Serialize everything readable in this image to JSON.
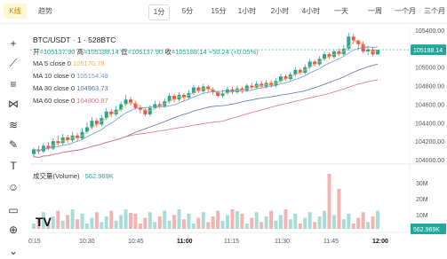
{
  "tabs": {
    "kline": "K线",
    "trend": "趋势"
  },
  "timeframes": [
    "1分",
    "5分",
    "15分",
    "1小时",
    "2小时",
    "4小时",
    "一天",
    "一周",
    "一个月",
    "三个月"
  ],
  "active_timeframe": "1分",
  "header": {
    "pair_line": "BTC/USDT · 1 · 528BTC",
    "ohlc": {
      "open_label": "开",
      "open": "=105137.90",
      "high_label": "高",
      "high": "=105188.14",
      "low_label": "低",
      "low": "=105137.90",
      "close_label": "收",
      "close": "=105188.14",
      "change": "+50.24 (+0.05%)"
    }
  },
  "ma_lines": [
    {
      "label": "MA 5 close 0",
      "value": "105170.78",
      "color": "#f5b342"
    },
    {
      "label": "MA 10 close 0",
      "value": "105154.49",
      "color": "#6f9ad8"
    },
    {
      "label": "MA 30 close 0",
      "value": "104963.73",
      "color": "#5a6fb0"
    },
    {
      "label": "MA 60 close 0",
      "value": "104800.87",
      "color": "#e8707a"
    }
  ],
  "volume": {
    "label": "成交量(Volume)",
    "value": "562.969K"
  },
  "price_axis": {
    "ticks": [
      "105400.00",
      "105200.00",
      "105000.00",
      "104800.00",
      "104600.00",
      "104400.00",
      "104200.00",
      "104000.00"
    ],
    "current": "105188.14"
  },
  "volume_axis": {
    "ticks": [
      "30M",
      "20M",
      "10M"
    ],
    "current": "562.969K"
  },
  "time_axis": [
    "0:15",
    "10:30",
    "10:45",
    "11:00",
    "11:15",
    "11:30",
    "11:45",
    "12:00"
  ],
  "colors": {
    "up": "#26a69a",
    "down": "#ef5350",
    "accent": "#26a69a"
  },
  "icons": [
    "crosshair-icon",
    "trend-line-icon",
    "horizontal-lines-icon",
    "pattern-icon",
    "fib-icon",
    "brush-icon",
    "text-icon",
    "emoji-icon",
    "ruler-icon",
    "zoom-in-icon",
    "more-icon"
  ],
  "chart_data": {
    "type": "candlestick",
    "ylim": [
      104000,
      105400
    ],
    "candles": [
      [
        104060,
        104110,
        104020,
        104130
      ],
      [
        104110,
        104090,
        104060,
        104150
      ],
      [
        104090,
        104150,
        104070,
        104180
      ],
      [
        104150,
        104120,
        104100,
        104190
      ],
      [
        104120,
        104200,
        104100,
        104230
      ],
      [
        104200,
        104180,
        104150,
        104260
      ],
      [
        104180,
        104240,
        104160,
        104280
      ],
      [
        104240,
        104210,
        104180,
        104270
      ],
      [
        104210,
        104260,
        104190,
        104300
      ],
      [
        104260,
        104230,
        104200,
        104290
      ],
      [
        104230,
        104300,
        104210,
        104340
      ],
      [
        104300,
        104350,
        104280,
        104400
      ],
      [
        104350,
        104420,
        104330,
        104460
      ],
      [
        104420,
        104380,
        104350,
        104450
      ],
      [
        104380,
        104450,
        104360,
        104480
      ],
      [
        104450,
        104520,
        104430,
        104560
      ],
      [
        104520,
        104490,
        104460,
        104550
      ],
      [
        104490,
        104540,
        104470,
        104580
      ],
      [
        104540,
        104600,
        104520,
        104630
      ],
      [
        104600,
        104650,
        104580,
        104700
      ],
      [
        104650,
        104610,
        104580,
        104680
      ],
      [
        104610,
        104560,
        104540,
        104630
      ],
      [
        104560,
        104540,
        104500,
        104590
      ],
      [
        104540,
        104490,
        104470,
        104560
      ],
      [
        104490,
        104560,
        104470,
        104590
      ],
      [
        104560,
        104600,
        104540,
        104640
      ],
      [
        104600,
        104580,
        104550,
        104630
      ],
      [
        104580,
        104630,
        104560,
        104660
      ],
      [
        104630,
        104690,
        104610,
        104720
      ],
      [
        104690,
        104650,
        104620,
        104710
      ],
      [
        104650,
        104700,
        104630,
        104730
      ],
      [
        104700,
        104670,
        104640,
        104720
      ],
      [
        104670,
        104720,
        104650,
        104750
      ],
      [
        104720,
        104780,
        104700,
        104810
      ],
      [
        104780,
        104740,
        104720,
        104800
      ],
      [
        104740,
        104790,
        104720,
        104820
      ],
      [
        104790,
        104760,
        104730,
        104810
      ],
      [
        104760,
        104730,
        104700,
        104780
      ],
      [
        104730,
        104690,
        104670,
        104750
      ],
      [
        104690,
        104720,
        104670,
        104760
      ],
      [
        104720,
        104760,
        104700,
        104790
      ],
      [
        104760,
        104730,
        104710,
        104790
      ],
      [
        104730,
        104770,
        104710,
        104800
      ],
      [
        104770,
        104750,
        104720,
        104790
      ],
      [
        104750,
        104800,
        104730,
        104820
      ],
      [
        104800,
        104780,
        104760,
        104830
      ],
      [
        104780,
        104820,
        104760,
        104850
      ],
      [
        104820,
        104790,
        104770,
        104850
      ],
      [
        104790,
        104830,
        104770,
        104860
      ],
      [
        104830,
        104800,
        104780,
        104860
      ],
      [
        104800,
        104850,
        104780,
        104880
      ],
      [
        104850,
        104900,
        104830,
        104930
      ],
      [
        104900,
        104870,
        104850,
        104920
      ],
      [
        104870,
        104920,
        104850,
        104950
      ],
      [
        104920,
        104970,
        104900,
        105000
      ],
      [
        104970,
        104940,
        104920,
        104990
      ],
      [
        104940,
        105000,
        104920,
        105030
      ],
      [
        105000,
        105060,
        104980,
        105090
      ],
      [
        105060,
        105030,
        105010,
        105080
      ],
      [
        105030,
        105090,
        105010,
        105120
      ],
      [
        105090,
        105140,
        105070,
        105170
      ],
      [
        105140,
        105110,
        105090,
        105160
      ],
      [
        105110,
        105170,
        105090,
        105190
      ],
      [
        105170,
        105140,
        105120,
        105200
      ],
      [
        105140,
        105200,
        105120,
        105240
      ],
      [
        105200,
        105330,
        105180,
        105370
      ],
      [
        105330,
        105290,
        105250,
        105360
      ],
      [
        105290,
        105250,
        105190,
        105300
      ],
      [
        105250,
        105170,
        105150,
        105280
      ],
      [
        105170,
        105190,
        105130,
        105230
      ],
      [
        105190,
        105138,
        105120,
        105220
      ],
      [
        105138,
        105188,
        105137,
        105188
      ]
    ]
  }
}
